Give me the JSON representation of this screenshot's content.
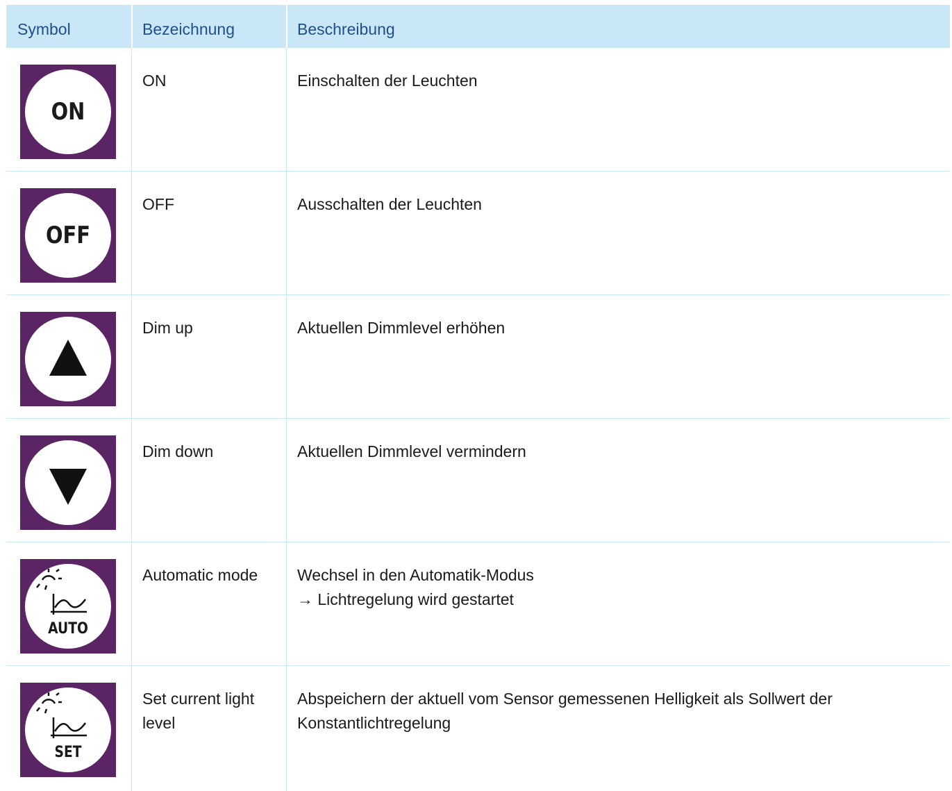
{
  "table": {
    "headers": {
      "symbol": "Symbol",
      "name": "Bezeichnung",
      "description": "Beschreibung"
    },
    "rows": [
      {
        "icon": "on-button-icon",
        "icon_text": "ON",
        "name": "ON",
        "description": [
          "Einschalten der Leuchten"
        ]
      },
      {
        "icon": "off-button-icon",
        "icon_text": "OFF",
        "name": "OFF",
        "description": [
          "Ausschalten der Leuchten"
        ]
      },
      {
        "icon": "dim-up-icon",
        "icon_text": "",
        "name": "Dim up",
        "description": [
          "Aktuellen Dimmlevel erhöhen"
        ]
      },
      {
        "icon": "dim-down-icon",
        "icon_text": "",
        "name": "Dim down",
        "description": [
          "Aktuellen Dimmlevel vermindern"
        ]
      },
      {
        "icon": "auto-mode-icon",
        "icon_text": "AUTO",
        "name": "Automatic mode",
        "description": [
          "Wechsel in den Automatik-Modus",
          "→ Lichtregelung wird gestartet"
        ]
      },
      {
        "icon": "set-light-level-icon",
        "icon_text": "SET",
        "name": "Set current light level",
        "description": [
          "Abspeichern der aktuell vom Sensor gemessenen Helligkeit als Sollwert der Konstantlichtregelung"
        ]
      }
    ]
  },
  "colors": {
    "header_bg": "#c9e7f7",
    "header_text": "#1f4f8a",
    "icon_tile": "#5b2464",
    "row_border": "#c9e7f7"
  }
}
